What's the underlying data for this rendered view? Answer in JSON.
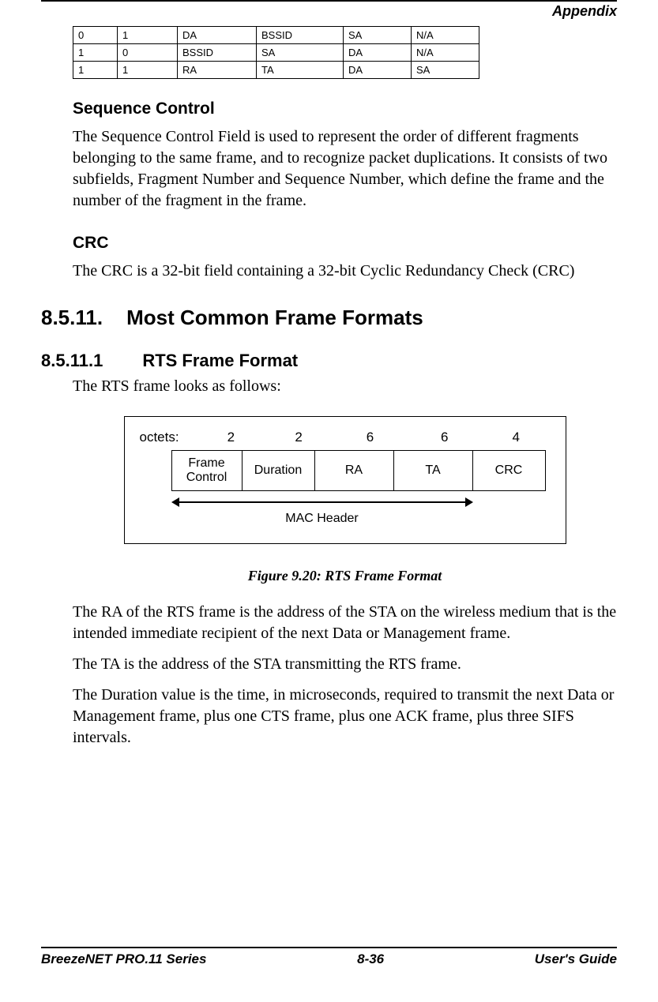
{
  "header": {
    "label": "Appendix"
  },
  "addr_table": {
    "rows": [
      [
        "0",
        "1",
        "DA",
        "BSSID",
        "SA",
        "N/A"
      ],
      [
        "1",
        "0",
        "BSSID",
        "SA",
        "DA",
        "N/A"
      ],
      [
        "1",
        "1",
        "RA",
        "TA",
        "DA",
        "SA"
      ]
    ]
  },
  "sequence_control": {
    "heading": "Sequence Control",
    "body": "The Sequence Control Field is used to represent the order of different fragments belonging to the same frame, and to recognize packet duplications. It consists of two subfields, Fragment Number and Sequence Number, which define the frame and the number of the fragment in the frame."
  },
  "crc": {
    "heading": "CRC",
    "body": "The CRC is a 32-bit field containing a 32-bit Cyclic Redundancy Check (CRC)"
  },
  "section": {
    "num": "8.5.11.",
    "title": "Most Common Frame Formats"
  },
  "subsection": {
    "num": "8.5.11.1",
    "title": "RTS Frame Format",
    "intro": "The RTS frame looks as follows:"
  },
  "rts_figure": {
    "octets_label": "octets:",
    "octets": [
      "2",
      "2",
      "6",
      "6",
      "4"
    ],
    "fields": [
      "Frame\nControl",
      "Duration",
      "RA",
      "TA",
      "CRC"
    ],
    "mac_header_label": "MAC Header"
  },
  "figure_caption": "Figure 9.20: RTS Frame Format",
  "paragraphs": {
    "p1": "The RA of the RTS frame is the address of the STA on the wireless medium that is the intended immediate recipient of the next Data or Management frame.",
    "p2": "The TA is the address of the STA transmitting the RTS frame.",
    "p3": "The Duration value is the time, in microseconds, required to transmit the next Data or Management frame, plus one CTS frame, plus one ACK frame, plus three SIFS intervals."
  },
  "footer": {
    "left": "BreezeNET PRO.11 Series",
    "center": "8-36",
    "right": "User's Guide"
  }
}
